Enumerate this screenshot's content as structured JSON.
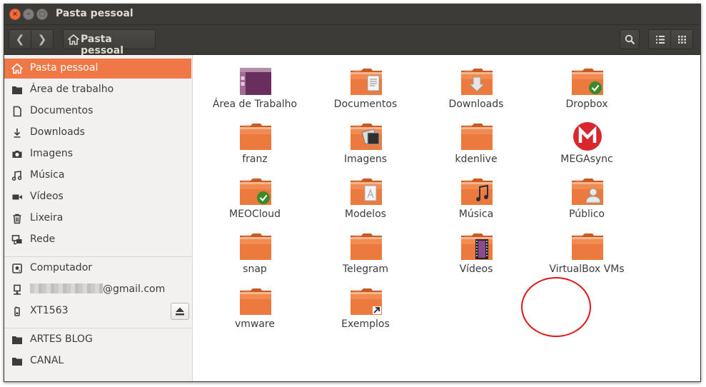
{
  "window": {
    "title": "Pasta pessoal"
  },
  "toolbar": {
    "location": "Pasta pessoal"
  },
  "sidebar": {
    "items": [
      {
        "label": "Pasta pessoal",
        "icon": "home-icon"
      },
      {
        "label": "Área de trabalho",
        "icon": "folder-icon"
      },
      {
        "label": "Documentos",
        "icon": "document-icon"
      },
      {
        "label": "Downloads",
        "icon": "download-icon"
      },
      {
        "label": "Imagens",
        "icon": "camera-icon"
      },
      {
        "label": "Música",
        "icon": "music-icon"
      },
      {
        "label": "Vídeos",
        "icon": "video-icon"
      },
      {
        "label": "Lixeira",
        "icon": "trash-icon"
      },
      {
        "label": "Rede",
        "icon": "network-icon"
      }
    ],
    "devices": [
      {
        "label": "Computador",
        "icon": "harddisk-icon"
      },
      {
        "label": "@gmail.com",
        "icon": "network-drive-icon"
      },
      {
        "label": "XT1563",
        "icon": "phone-icon"
      }
    ],
    "bookmarks": [
      {
        "label": "ARTES BLOG",
        "icon": "folder-icon"
      },
      {
        "label": "CANAL",
        "icon": "folder-icon"
      }
    ]
  },
  "files": [
    {
      "name": "Área de Trabalho",
      "icon": "desktop-icon"
    },
    {
      "name": "Documentos",
      "icon": "folder-documents-icon"
    },
    {
      "name": "Downloads",
      "icon": "folder-download-icon"
    },
    {
      "name": "Dropbox",
      "icon": "folder-dropbox-icon"
    },
    {
      "name": "franz",
      "icon": "folder-icon"
    },
    {
      "name": "Imagens",
      "icon": "folder-pictures-icon"
    },
    {
      "name": "kdenlive",
      "icon": "folder-icon"
    },
    {
      "name": "MEGAsync",
      "icon": "mega-icon"
    },
    {
      "name": "MEOCloud",
      "icon": "folder-sync-icon"
    },
    {
      "name": "Modelos",
      "icon": "folder-templates-icon"
    },
    {
      "name": "Música",
      "icon": "folder-music-icon"
    },
    {
      "name": "Público",
      "icon": "folder-public-icon"
    },
    {
      "name": "snap",
      "icon": "folder-icon"
    },
    {
      "name": "Telegram",
      "icon": "folder-icon"
    },
    {
      "name": "Vídeos",
      "icon": "folder-videos-icon"
    },
    {
      "name": "VirtualBox VMs",
      "icon": "folder-icon"
    },
    {
      "name": "vmware",
      "icon": "folder-icon"
    },
    {
      "name": "Exemplos",
      "icon": "folder-link-icon"
    }
  ],
  "colors": {
    "accent": "#f07746",
    "titlebar": "#3c3b37",
    "folder": "#e8743b",
    "highlight_circle": "#e01818"
  }
}
